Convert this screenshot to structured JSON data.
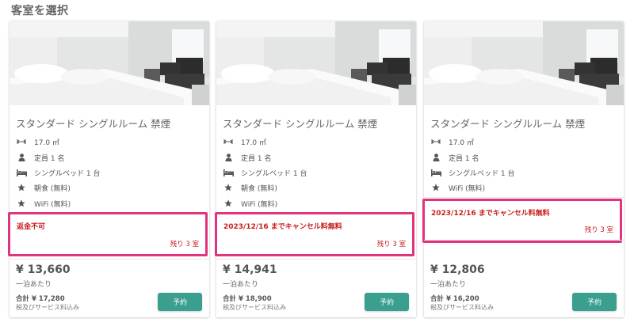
{
  "section_title": "客室を選択",
  "colors": {
    "accent": "#3a9f8e",
    "warning": "#c81e1e",
    "highlight_border": "#e2337f"
  },
  "rooms": [
    {
      "name": "スタンダード シングルルーム 禁煙",
      "features": [
        {
          "icon": "area-arrows-icon",
          "label": "17.0 ㎡"
        },
        {
          "icon": "person-icon",
          "label": "定員 1 名"
        },
        {
          "icon": "bed-icon",
          "label": "シングルベッド 1 台"
        },
        {
          "icon": "star-icon",
          "label": "朝食 (無料)"
        },
        {
          "icon": "star-icon",
          "label": "WiFi (無料)"
        }
      ],
      "policy": "返金不可",
      "remaining": "残り 3 室",
      "price": "¥ 13,660",
      "per_night": "一泊あたり",
      "total": "合計 ¥ 17,280",
      "tax_note": "税及びサービス料込み",
      "button": "予約"
    },
    {
      "name": "スタンダード シングルルーム 禁煙",
      "features": [
        {
          "icon": "area-arrows-icon",
          "label": "17.0 ㎡"
        },
        {
          "icon": "person-icon",
          "label": "定員 1 名"
        },
        {
          "icon": "bed-icon",
          "label": "シングルベッド 1 台"
        },
        {
          "icon": "star-icon",
          "label": "朝食 (無料)"
        },
        {
          "icon": "star-icon",
          "label": "WiFi (無料)"
        }
      ],
      "policy": "2023/12/16 までキャンセル料無料",
      "remaining": "残り 3 室",
      "price": "¥ 14,941",
      "per_night": "一泊あたり",
      "total": "合計 ¥ 18,900",
      "tax_note": "税及びサービス料込み",
      "button": "予約"
    },
    {
      "name": "スタンダード シングルルーム 禁煙",
      "features": [
        {
          "icon": "area-arrows-icon",
          "label": "17.0 ㎡"
        },
        {
          "icon": "person-icon",
          "label": "定員 1 名"
        },
        {
          "icon": "bed-icon",
          "label": "シングルベッド 1 台"
        },
        {
          "icon": "star-icon",
          "label": "WiFi (無料)"
        }
      ],
      "policy": "2023/12/16 までキャンセル料無料",
      "remaining": "残り 3 室",
      "price": "¥ 12,806",
      "per_night": "一泊あたり",
      "total": "合計 ¥ 16,200",
      "tax_note": "税及びサービス料込み",
      "button": "予約"
    }
  ]
}
